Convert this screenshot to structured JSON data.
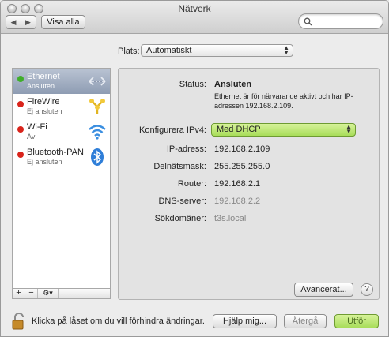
{
  "window": {
    "title": "Nätverk"
  },
  "toolbar": {
    "back_glyph": "◀",
    "forward_glyph": "▶",
    "show_all_label": "Visa alla",
    "search_placeholder": ""
  },
  "location": {
    "label": "Plats:",
    "value": "Automatiskt"
  },
  "services": [
    {
      "name": "Ethernet",
      "status": "Ansluten",
      "status_color": "#3fae2a",
      "icon": "ethernet-icon",
      "selected": true
    },
    {
      "name": "FireWire",
      "status": "Ej ansluten",
      "status_color": "#d9241b",
      "icon": "firewire-icon",
      "selected": false
    },
    {
      "name": "Wi-Fi",
      "status": "Av",
      "status_color": "#d9241b",
      "icon": "wifi-icon",
      "selected": false
    },
    {
      "name": "Bluetooth-PAN",
      "status": "Ej ansluten",
      "status_color": "#d9241b",
      "icon": "bluetooth-icon",
      "selected": false
    }
  ],
  "sidebar_tools": {
    "add": "+",
    "remove": "−",
    "gear": "⚙▾"
  },
  "details": {
    "status_label": "Status:",
    "status_value": "Ansluten",
    "status_description": "Ethernet är för närvarande aktivt och har IP-adressen 192.168.2.109.",
    "configure_label": "Konfigurera IPv4:",
    "configure_value": "Med DHCP",
    "ip_label": "IP-adress:",
    "ip_value": "192.168.2.109",
    "subnet_label": "Delnätsmask:",
    "subnet_value": "255.255.255.0",
    "router_label": "Router:",
    "router_value": "192.168.2.1",
    "dns_label": "DNS-server:",
    "dns_value": "192.168.2.2",
    "search_domains_label": "Sökdomäner:",
    "search_domains_value": "t3s.local",
    "advanced_label": "Avancerat...",
    "help_label": "?"
  },
  "footer": {
    "lock_text": "Klicka på låset om du vill förhindra ändringar.",
    "assist_label": "Hjälp mig...",
    "revert_label": "Återgå",
    "apply_label": "Utför"
  },
  "colors": {
    "accent_green": "#a8dd5a",
    "selection": "#8e9cb3"
  }
}
